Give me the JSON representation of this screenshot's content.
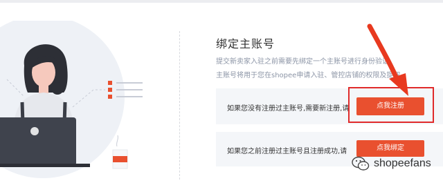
{
  "section": {
    "title": "绑定主账号",
    "description_line1": "提交新卖家入驻之前需要先绑定一个主账号进行身份验证,",
    "description_line2": "主账号将用于您在shopee申请入驻、管控店铺的权限及提取"
  },
  "option_new": {
    "text": "如果您没有注册过主账号,需要新注册,请",
    "button_label": "点我注册"
  },
  "option_existing": {
    "text": "如果您之前注册过主账号且注册成功,请",
    "button_label": "点我绑定"
  },
  "watermark": {
    "text": "shopeefans",
    "icon": "wechat-icon"
  },
  "colors": {
    "accent": "#e9502f",
    "highlight": "#e02a2a",
    "card_bg": "#f4f6f9",
    "muted_text": "#8c95a6"
  }
}
